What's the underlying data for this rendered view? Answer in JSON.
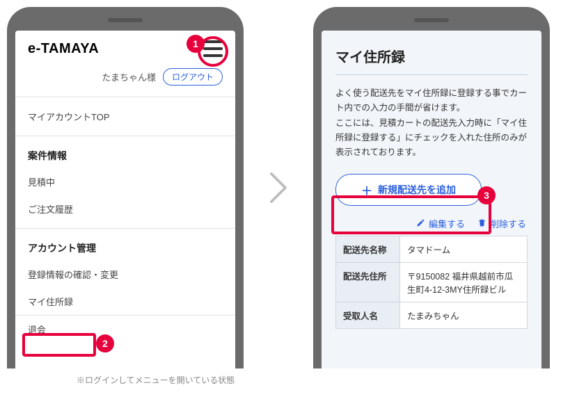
{
  "left": {
    "brand": "e-TAMAYA",
    "user_label": "たまちゃん様",
    "logout_label": "ログアウト",
    "menu": {
      "top": "マイアカウントTOP",
      "section_cases": "案件情報",
      "item_quote": "見積中",
      "item_orders": "ご注文履歴",
      "section_account": "アカウント管理",
      "item_reg": "登録情報の確認・変更",
      "item_address": "マイ住所録",
      "item_withdraw": "退会"
    }
  },
  "right": {
    "title": "マイ住所録",
    "description": "よく使う配送先をマイ住所録に登録する事でカート内での入力の手間が省けます。\nここには、見積カートの配送先入力時に「マイ住所録に登録する」にチェックを入れた住所のみが表示されております。",
    "add_button": "新規配送先を追加",
    "action_edit": "編集する",
    "action_delete": "削除する",
    "table": {
      "name_label": "配送先名称",
      "name_value": "タマドーム",
      "address_label": "配送先住所",
      "address_value": "〒9150082 福井県越前市瓜生町4-12-3MY住所録ビル",
      "recipient_label": "受取人名",
      "recipient_value": "たまみちゃん"
    }
  },
  "callouts": {
    "b1": "1",
    "b2": "2",
    "b3": "3"
  },
  "footnote": "※ログインしてメニューを開いている状態"
}
